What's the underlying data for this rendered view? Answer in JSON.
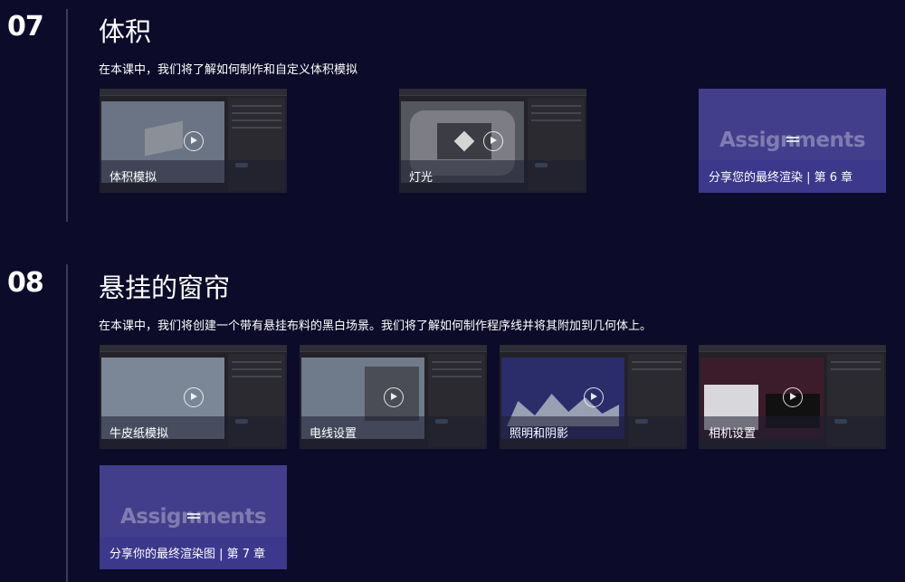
{
  "sections": [
    {
      "number": "07",
      "title": "体积",
      "description": "在本课中，我们将了解如何制作和自定义体积模拟",
      "cards": [
        {
          "label": "体积模拟",
          "type": "video"
        },
        {
          "label": "灯光",
          "type": "video"
        },
        {
          "label": "分享您的最终渲染 | 第 6 章",
          "type": "assignment",
          "banner": "Assignments"
        }
      ]
    },
    {
      "number": "08",
      "title": "悬挂的窗帘",
      "description": "在本课中，我们将创建一个带有悬挂布料的黑白场景。我们将了解如何制作程序线并将其附加到几何体上。",
      "cards": [
        {
          "label": "牛皮纸模拟",
          "type": "video"
        },
        {
          "label": "电线设置",
          "type": "video"
        },
        {
          "label": "照明和阴影",
          "type": "video"
        },
        {
          "label": "相机设置",
          "type": "video"
        },
        {
          "label": "分享你的最终渲染图 | 第 7 章",
          "type": "assignment",
          "banner": "Assignments"
        }
      ]
    }
  ],
  "icons": {
    "play": "play-circle-icon",
    "assignment": "list-icon"
  },
  "colors": {
    "background": "#0c0b29",
    "assignment": "#433e8c",
    "divider": "#3a3a5e"
  }
}
